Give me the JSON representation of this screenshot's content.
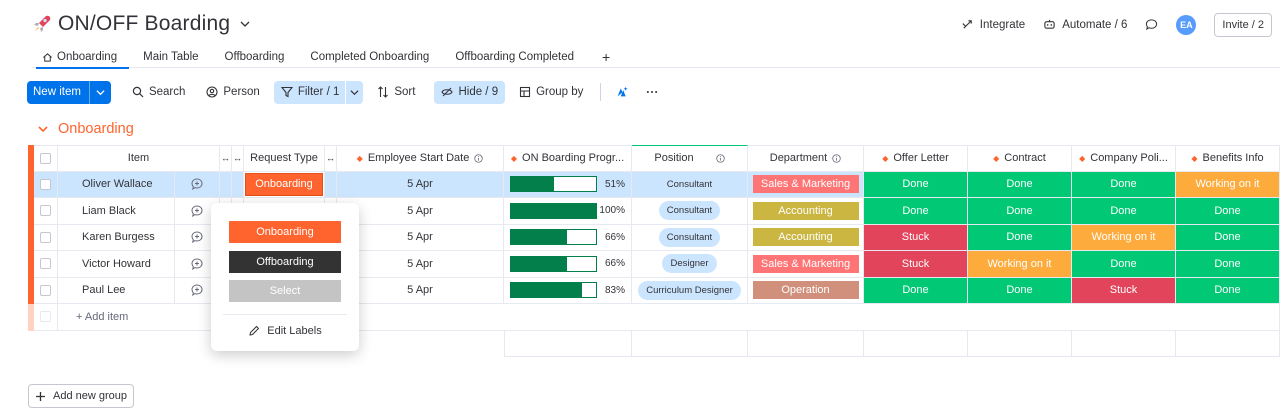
{
  "header": {
    "title": "ON/OFF Boarding",
    "integrate": "Integrate",
    "automate": "Automate / 6",
    "avatar": "EA",
    "invite": "Invite / 2"
  },
  "tabs": [
    {
      "label": "Onboarding"
    },
    {
      "label": "Main Table"
    },
    {
      "label": "Offboarding"
    },
    {
      "label": "Completed Onboarding"
    },
    {
      "label": "Offboarding Completed"
    }
  ],
  "toolbar": {
    "new_item": "New item",
    "search": "Search",
    "person": "Person",
    "filter": "Filter / 1",
    "sort": "Sort",
    "hide": "Hide / 9",
    "group_by": "Group by"
  },
  "group": {
    "title": "Onboarding",
    "add_item": "+ Add item"
  },
  "columns": {
    "item": "Item",
    "request_type": "Request Type",
    "start_date": "Employee Start Date",
    "progress": "ON Boarding Progr...",
    "position": "Position",
    "department": "Department",
    "offer_letter": "Offer Letter",
    "contract": "Contract",
    "company_policy": "Company Poli...",
    "benefits": "Benefits Info"
  },
  "rows": [
    {
      "name": "Oliver Wallace",
      "request": "Onboarding",
      "date": "5 Apr",
      "progress": 51,
      "progress_label": "51%",
      "position": "Consultant",
      "department": "Sales & Marketing",
      "offer": "Done",
      "contract": "Done",
      "policy": "Done",
      "benefits": "Working on it"
    },
    {
      "name": "Liam Black",
      "request": "",
      "date": "5 Apr",
      "progress": 100,
      "progress_label": "100%",
      "position": "Consultant",
      "department": "Accounting",
      "offer": "Done",
      "contract": "Done",
      "policy": "Done",
      "benefits": "Done"
    },
    {
      "name": "Karen Burgess",
      "request": "",
      "date": "5 Apr",
      "progress": 66,
      "progress_label": "66%",
      "position": "Consultant",
      "department": "Accounting",
      "offer": "Stuck",
      "contract": "Done",
      "policy": "Working on it",
      "benefits": "Done"
    },
    {
      "name": "Victor Howard",
      "request": "",
      "date": "5 Apr",
      "progress": 66,
      "progress_label": "66%",
      "position": "Designer",
      "department": "Sales & Marketing",
      "offer": "Stuck",
      "contract": "Working on it",
      "policy": "Done",
      "benefits": "Done"
    },
    {
      "name": "Paul Lee",
      "request": "",
      "date": "5 Apr",
      "progress": 83,
      "progress_label": "83%",
      "position": "Curriculum Designer",
      "department": "Operation",
      "offer": "Done",
      "contract": "Done",
      "policy": "Stuck",
      "benefits": "Done"
    }
  ],
  "dropdown": {
    "options": [
      "Onboarding",
      "Offboarding",
      "Select"
    ],
    "edit_labels": "Edit Labels"
  },
  "add_group": "Add new group",
  "colors": {
    "done": "#00c875",
    "stuck": "#e2445c",
    "working": "#fdab3d",
    "sales": "#ff7575",
    "accounting": "#cab641",
    "operation": "#d0907c",
    "onboarding": "#ff642e",
    "offboarding": "#333333",
    "select": "#c4c4c4",
    "accent": "#0073ea",
    "group": "#ff642e"
  }
}
